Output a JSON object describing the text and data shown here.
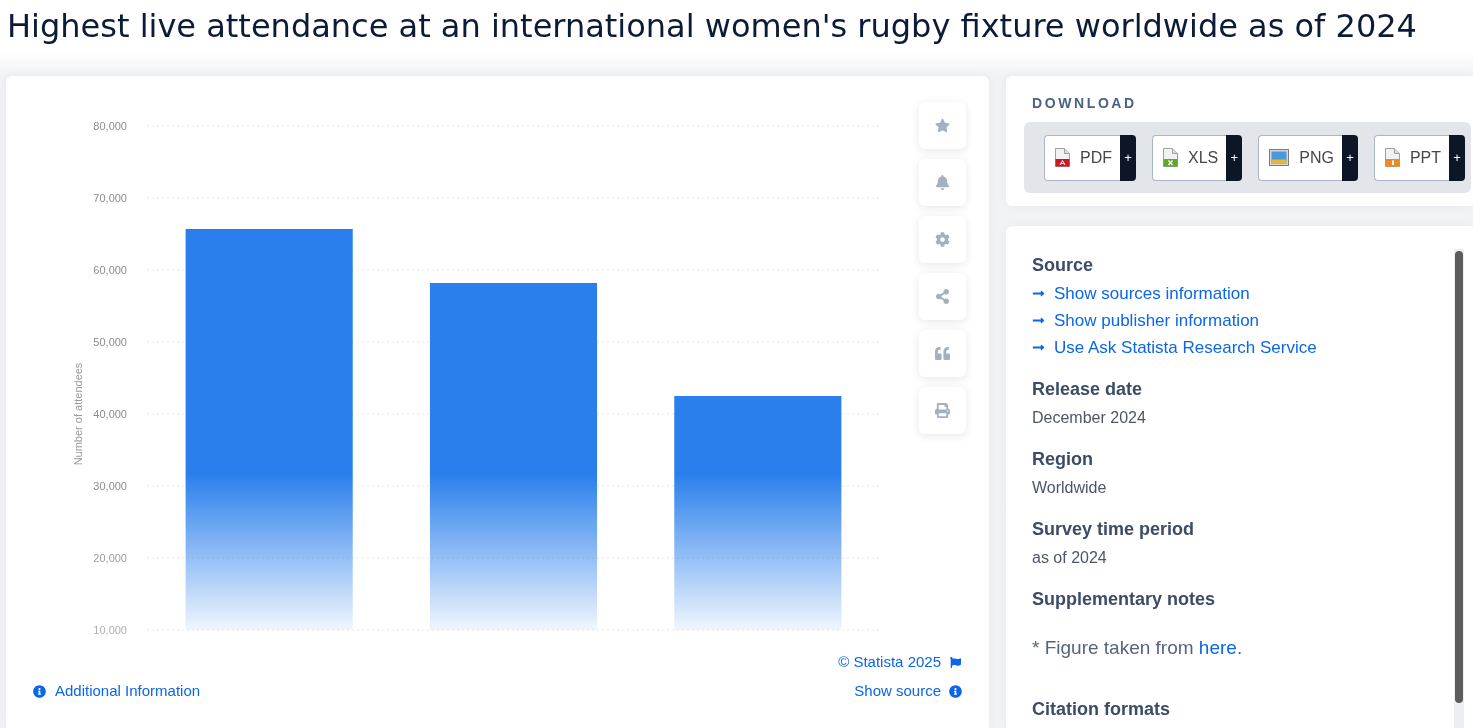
{
  "title": "Highest live attendance at an international women's rugby fixture worldwide as of 2024",
  "chart_card": {
    "chart_data": {
      "type": "bar",
      "ylabel": "Number of attendees",
      "series": [
        {
          "color": "#2a7fec",
          "values": [
            65700,
            58200,
            42500
          ]
        }
      ],
      "ylim": [
        10000,
        80000
      ],
      "grid": true,
      "yticks": [
        {
          "value": 80000,
          "label": "80,000"
        },
        {
          "value": 70000,
          "label": "70,000"
        },
        {
          "value": 60000,
          "label": "60,000"
        },
        {
          "value": 50000,
          "label": "50,000"
        },
        {
          "value": 40000,
          "label": "40,000"
        },
        {
          "value": 30000,
          "label": "30,000"
        },
        {
          "value": 20000,
          "label": "20,000"
        },
        {
          "value": 10000,
          "label": "10,000"
        }
      ]
    },
    "copyright": "© Statista 2025",
    "additional_information": "Additional Information",
    "show_source": "Show source"
  },
  "download": {
    "heading": "DOWNLOAD",
    "formats": [
      {
        "kind": "pdf",
        "label": "PDF",
        "more": "+"
      },
      {
        "kind": "xls",
        "label": "XLS",
        "more": "+"
      },
      {
        "kind": "png",
        "label": "PNG",
        "more": "+"
      },
      {
        "kind": "ppt",
        "label": "PPT",
        "more": "+"
      }
    ]
  },
  "details": [
    {
      "kind": "links",
      "heading": "Source",
      "links": [
        "Show sources information",
        "Show publisher information",
        "Use Ask Statista Research Service"
      ]
    },
    {
      "kind": "value",
      "heading": "Release date",
      "value": "December 2024"
    },
    {
      "kind": "value",
      "heading": "Region",
      "value": "Worldwide"
    },
    {
      "kind": "value",
      "heading": "Survey time period",
      "value": "as of 2024"
    },
    {
      "kind": "note",
      "heading": "Supplementary notes",
      "note": "* Figure taken from",
      "link": "here",
      "after": "."
    },
    {
      "kind": "heading",
      "heading": "Citation formats"
    }
  ]
}
